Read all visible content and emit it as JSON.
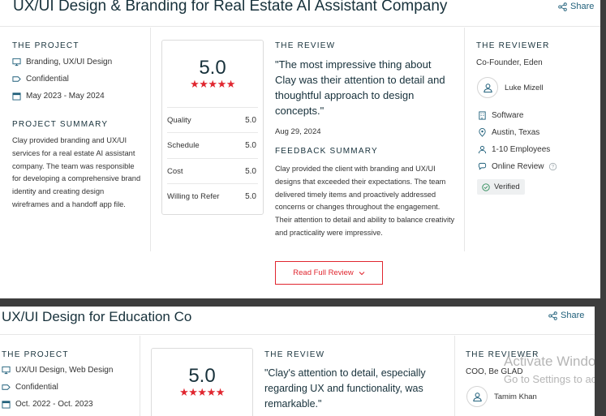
{
  "share_label": "Share",
  "colors": {
    "accent": "#e0262f",
    "link": "#1f5f7a",
    "heading": "#17313b"
  },
  "review1": {
    "title": "UX/UI Design & Branding for Real Estate AI Assistant Company",
    "project": {
      "heading": "THE PROJECT",
      "services": "Branding, UX/UI Design",
      "budget": "Confidential",
      "dates": "May 2023 - May 2024",
      "summary_heading": "PROJECT SUMMARY",
      "summary": "Clay provided branding and UX/UI services for a real estate AI assistant company. The team was responsible for developing a comprehensive brand identity and creating design wireframes and a handoff app file."
    },
    "rating": {
      "overall": "5.0",
      "stars": "★★★★★",
      "rows": [
        {
          "label": "Quality",
          "value": "5.0"
        },
        {
          "label": "Schedule",
          "value": "5.0"
        },
        {
          "label": "Cost",
          "value": "5.0"
        },
        {
          "label": "Willing to Refer",
          "value": "5.0"
        }
      ]
    },
    "review": {
      "heading": "THE REVIEW",
      "quote": "\"The most impressive thing about Clay was their attention to detail and thoughtful approach to design concepts.\"",
      "date": "Aug 29, 2024",
      "feedback_heading": "FEEDBACK SUMMARY",
      "feedback": "Clay provided the client with branding and UX/UI designs that exceeded their expectations. The team delivered timely items and proactively addressed concerns or changes throughout the engagement. Their attention to detail and ability to balance creativity and practicality were impressive.",
      "read_more": "Read Full Review"
    },
    "reviewer": {
      "heading": "THE REVIEWER",
      "role": "Co-Founder, Eden",
      "name": "Luke Mizell",
      "industry": "Software",
      "location": "Austin, Texas",
      "size": "1-10 Employees",
      "review_type": "Online Review",
      "verified": "Verified"
    }
  },
  "review2": {
    "title": "UX/UI Design for Education Co",
    "project": {
      "heading": "THE PROJECT",
      "services": "UX/UI Design, Web Design",
      "budget": "Confidential",
      "dates": "Oct. 2022 - Oct. 2023"
    },
    "rating": {
      "overall": "5.0",
      "stars": "★★★★★"
    },
    "review": {
      "heading": "THE REVIEW",
      "quote": "\"Clay's attention to detail, especially regarding UX and functionality, was remarkable.\""
    },
    "reviewer": {
      "heading": "THE REVIEWER",
      "role": "COO, Be GLAD",
      "name": "Tamim Khan"
    }
  },
  "watermark": {
    "line1": "Activate Windows",
    "line2": "Go to Settings to activate Windows."
  }
}
